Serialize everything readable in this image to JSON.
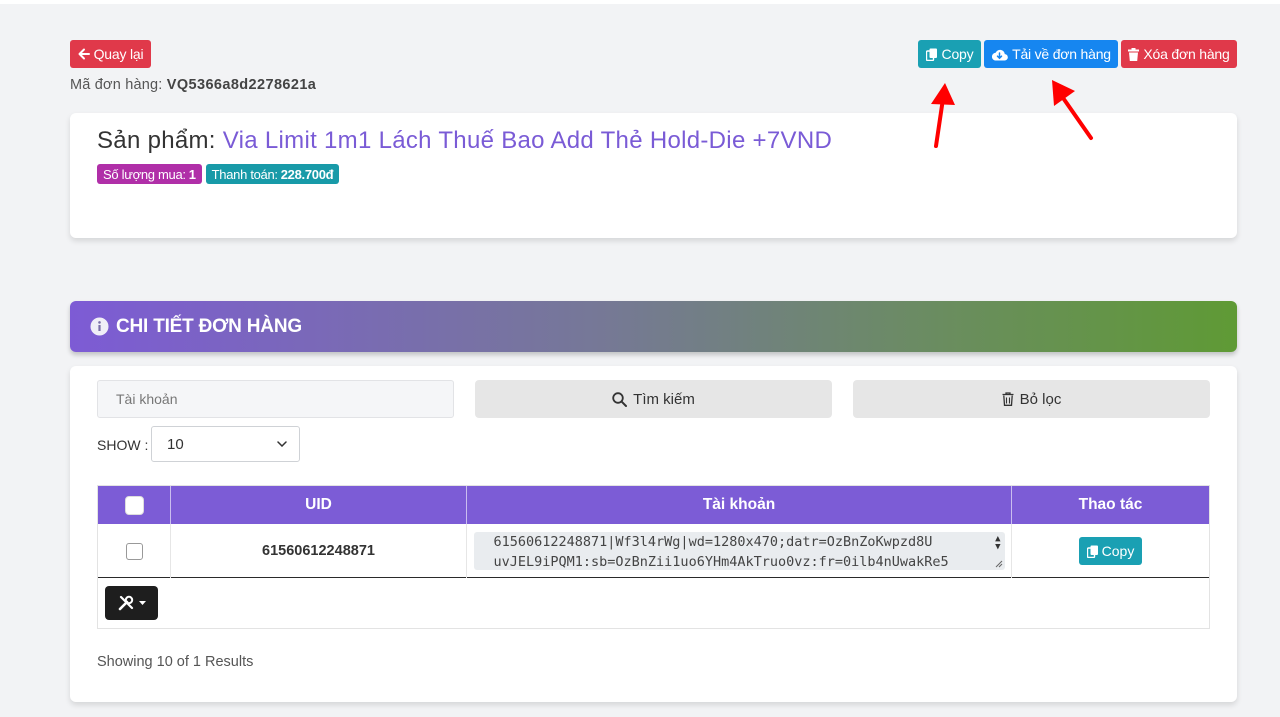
{
  "toolbar": {
    "back_label": "Quay lại",
    "copy_label": "Copy",
    "download_label": "Tải về đơn hàng",
    "delete_label": "Xóa đơn hàng"
  },
  "order": {
    "code_label": "Mã đơn hàng:",
    "code_value": "VQ5366a8d2278621a"
  },
  "product": {
    "title_prefix": "Sản phẩm:",
    "name": "Via Limit 1m1 Lách Thuế Bao Add Thẻ Hold-Die +7VND",
    "quantity_label": "Số lượng mua:",
    "quantity_value": "1",
    "payment_label": "Thanh toán:",
    "payment_value": "228.700đ"
  },
  "detail": {
    "header_title": "CHI TIẾT ĐƠN HÀNG",
    "search_placeholder": "Tài khoản",
    "search_button": "Tìm kiếm",
    "filter_button": "Bỏ lọc",
    "show_label": "SHOW :",
    "show_value": "10",
    "columns": [
      "UID",
      "Tài khoản",
      "Thao tác"
    ],
    "rows": [
      {
        "uid": "61560612248871",
        "account_line1": "61560612248871|Wf3l4rWg|wd=1280x470;datr=OzBnZoKwpzd8U",
        "account_line2": "uvJEL9iPQM1:sb=OzBnZii1uo6YHm4AkTruo0vz:fr=0ilb4nUwakRe5",
        "action_label": "Copy"
      }
    ],
    "showing_text": "Showing 10 of 1 Results"
  },
  "colors": {
    "accent_purple": "#7c5cd6",
    "danger": "#e0394a",
    "info": "#1aa0b3",
    "primary": "#1686f0",
    "annotation_arrow": "#ff0000"
  }
}
